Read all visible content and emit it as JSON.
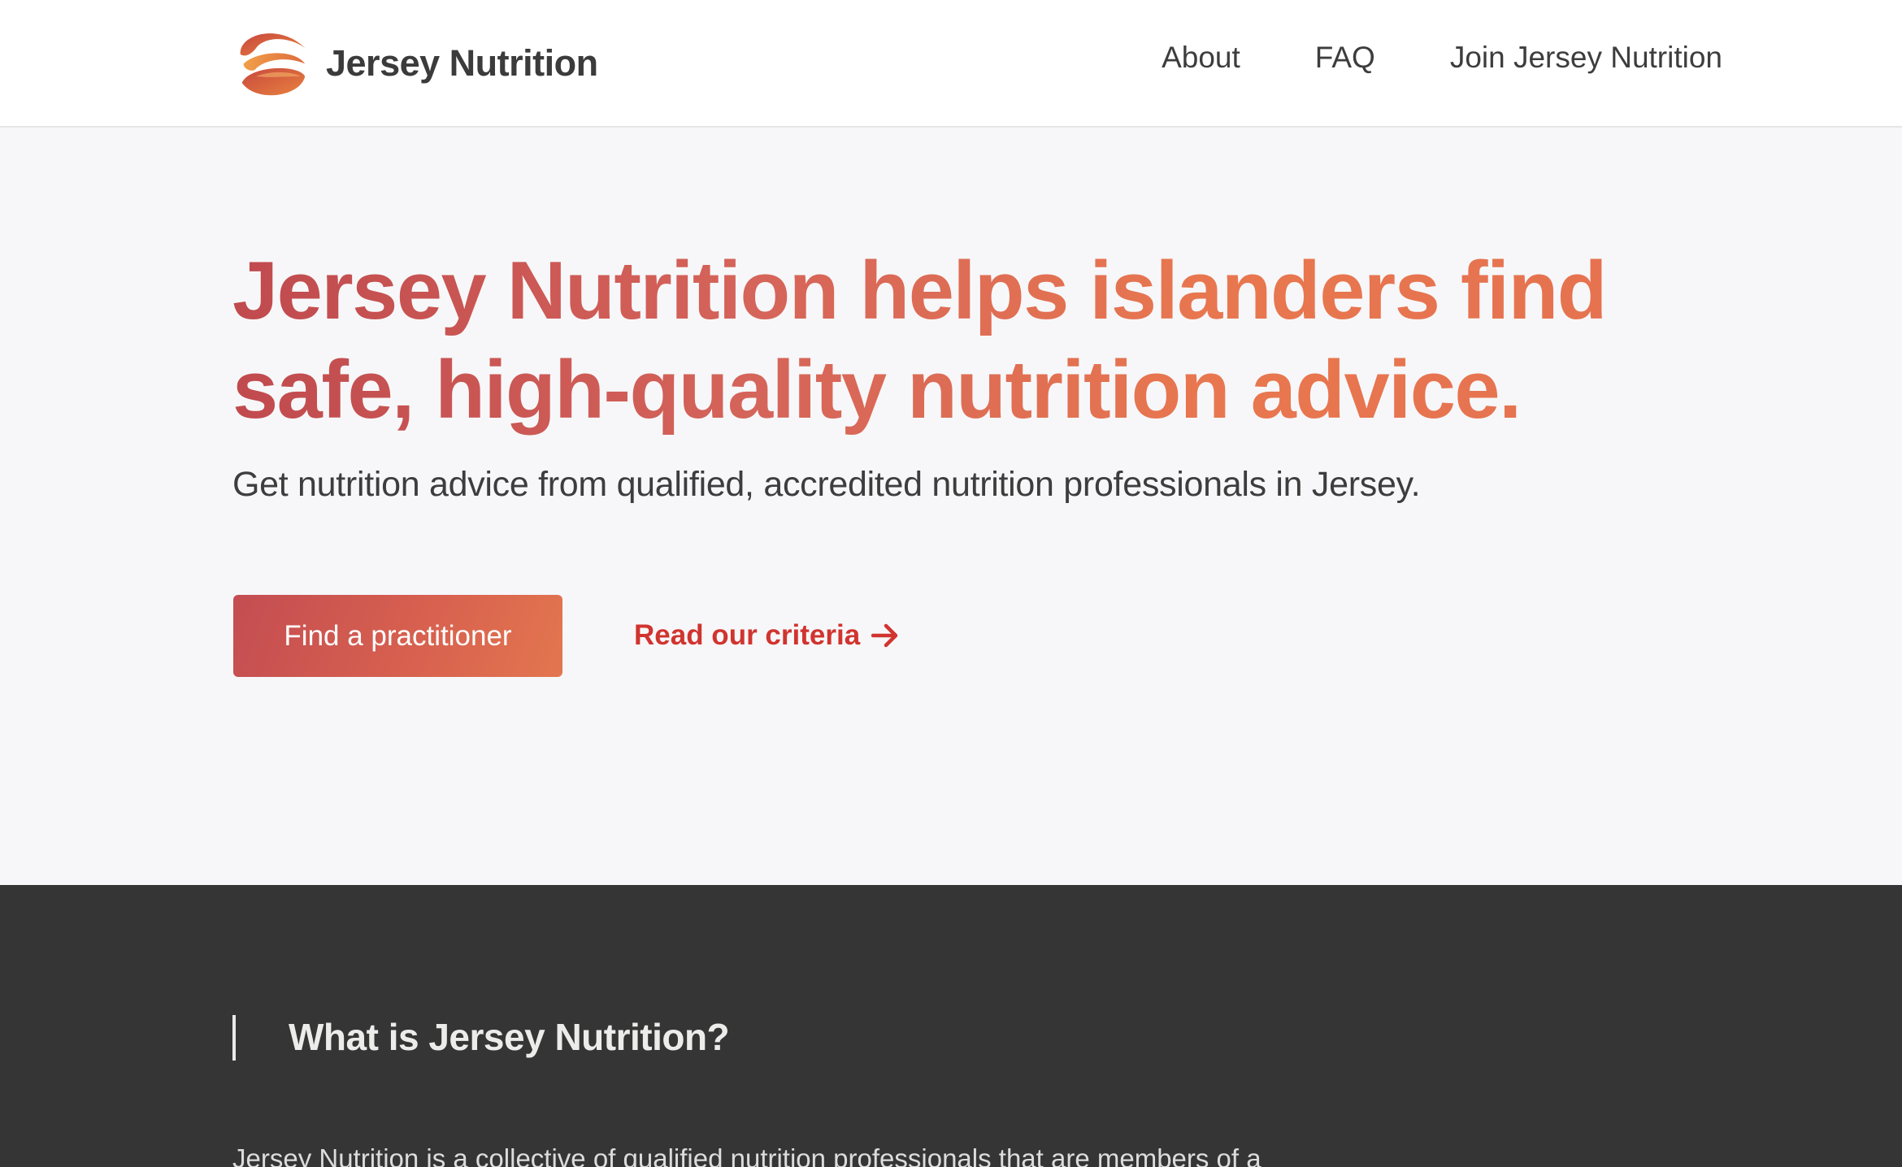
{
  "header": {
    "brand_name": "Jersey Nutrition",
    "logo_icon": "jersey-nutrition-swirl-logo",
    "nav": [
      {
        "label": "About"
      },
      {
        "label": "FAQ"
      },
      {
        "label": "Join Jersey Nutrition"
      }
    ]
  },
  "hero": {
    "title_line1": "Jersey Nutrition helps islanders find",
    "title_line2": "safe, high-quality nutrition advice.",
    "subtitle": "Get nutrition advice from qualified, accredited nutrition professionals in Jersey.",
    "primary_button": "Find a practitioner",
    "secondary_link": "Read our criteria",
    "secondary_link_icon": "arrow-right-icon"
  },
  "about": {
    "title": "What is Jersey Nutrition?",
    "body": "Jersey Nutrition is a collective of qualified nutrition professionals that are members of a"
  },
  "colors": {
    "accent_start": "#c04a4e",
    "accent_end": "#e8774f",
    "link_red": "#d1342f",
    "dark_section": "#353536",
    "hero_bg": "#f7f7f9"
  }
}
